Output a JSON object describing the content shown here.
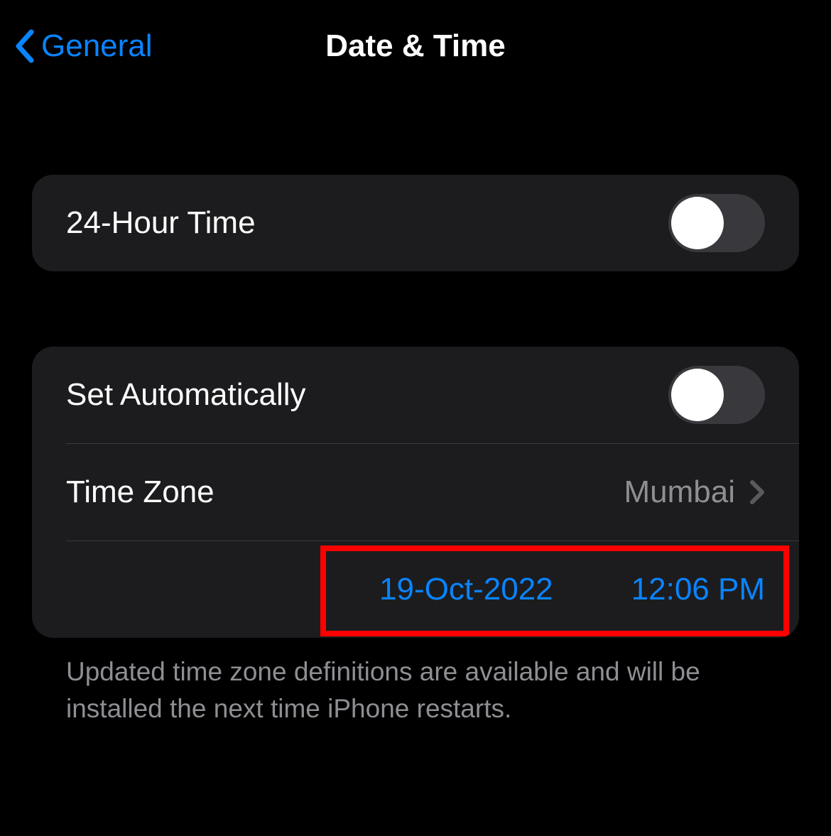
{
  "header": {
    "back_label": "General",
    "title": "Date & Time"
  },
  "group1": {
    "twenty_four_hour_label": "24-Hour Time"
  },
  "group2": {
    "set_automatically_label": "Set Automatically",
    "time_zone_label": "Time Zone",
    "time_zone_value": "Mumbai",
    "date_value": "19-Oct-2022",
    "time_value": "12:06 PM"
  },
  "footer": {
    "text": "Updated time zone definitions are available and will be installed the next time iPhone restarts."
  }
}
